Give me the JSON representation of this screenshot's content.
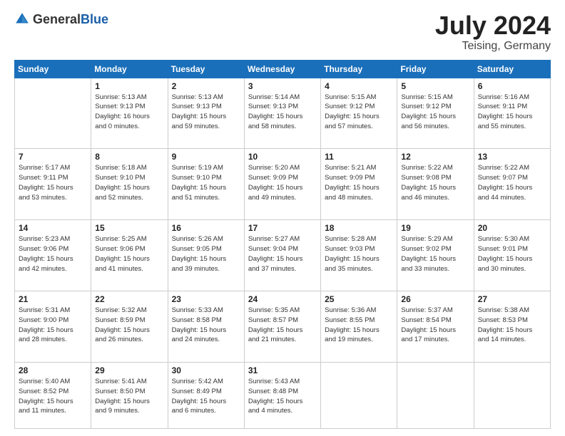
{
  "header": {
    "logo_general": "General",
    "logo_blue": "Blue",
    "month_year": "July 2024",
    "location": "Teising, Germany"
  },
  "weekdays": [
    "Sunday",
    "Monday",
    "Tuesday",
    "Wednesday",
    "Thursday",
    "Friday",
    "Saturday"
  ],
  "weeks": [
    [
      {
        "day": "",
        "info": ""
      },
      {
        "day": "1",
        "info": "Sunrise: 5:13 AM\nSunset: 9:13 PM\nDaylight: 16 hours\nand 0 minutes."
      },
      {
        "day": "2",
        "info": "Sunrise: 5:13 AM\nSunset: 9:13 PM\nDaylight: 15 hours\nand 59 minutes."
      },
      {
        "day": "3",
        "info": "Sunrise: 5:14 AM\nSunset: 9:13 PM\nDaylight: 15 hours\nand 58 minutes."
      },
      {
        "day": "4",
        "info": "Sunrise: 5:15 AM\nSunset: 9:12 PM\nDaylight: 15 hours\nand 57 minutes."
      },
      {
        "day": "5",
        "info": "Sunrise: 5:15 AM\nSunset: 9:12 PM\nDaylight: 15 hours\nand 56 minutes."
      },
      {
        "day": "6",
        "info": "Sunrise: 5:16 AM\nSunset: 9:11 PM\nDaylight: 15 hours\nand 55 minutes."
      }
    ],
    [
      {
        "day": "7",
        "info": "Sunrise: 5:17 AM\nSunset: 9:11 PM\nDaylight: 15 hours\nand 53 minutes."
      },
      {
        "day": "8",
        "info": "Sunrise: 5:18 AM\nSunset: 9:10 PM\nDaylight: 15 hours\nand 52 minutes."
      },
      {
        "day": "9",
        "info": "Sunrise: 5:19 AM\nSunset: 9:10 PM\nDaylight: 15 hours\nand 51 minutes."
      },
      {
        "day": "10",
        "info": "Sunrise: 5:20 AM\nSunset: 9:09 PM\nDaylight: 15 hours\nand 49 minutes."
      },
      {
        "day": "11",
        "info": "Sunrise: 5:21 AM\nSunset: 9:09 PM\nDaylight: 15 hours\nand 48 minutes."
      },
      {
        "day": "12",
        "info": "Sunrise: 5:22 AM\nSunset: 9:08 PM\nDaylight: 15 hours\nand 46 minutes."
      },
      {
        "day": "13",
        "info": "Sunrise: 5:22 AM\nSunset: 9:07 PM\nDaylight: 15 hours\nand 44 minutes."
      }
    ],
    [
      {
        "day": "14",
        "info": "Sunrise: 5:23 AM\nSunset: 9:06 PM\nDaylight: 15 hours\nand 42 minutes."
      },
      {
        "day": "15",
        "info": "Sunrise: 5:25 AM\nSunset: 9:06 PM\nDaylight: 15 hours\nand 41 minutes."
      },
      {
        "day": "16",
        "info": "Sunrise: 5:26 AM\nSunset: 9:05 PM\nDaylight: 15 hours\nand 39 minutes."
      },
      {
        "day": "17",
        "info": "Sunrise: 5:27 AM\nSunset: 9:04 PM\nDaylight: 15 hours\nand 37 minutes."
      },
      {
        "day": "18",
        "info": "Sunrise: 5:28 AM\nSunset: 9:03 PM\nDaylight: 15 hours\nand 35 minutes."
      },
      {
        "day": "19",
        "info": "Sunrise: 5:29 AM\nSunset: 9:02 PM\nDaylight: 15 hours\nand 33 minutes."
      },
      {
        "day": "20",
        "info": "Sunrise: 5:30 AM\nSunset: 9:01 PM\nDaylight: 15 hours\nand 30 minutes."
      }
    ],
    [
      {
        "day": "21",
        "info": "Sunrise: 5:31 AM\nSunset: 9:00 PM\nDaylight: 15 hours\nand 28 minutes."
      },
      {
        "day": "22",
        "info": "Sunrise: 5:32 AM\nSunset: 8:59 PM\nDaylight: 15 hours\nand 26 minutes."
      },
      {
        "day": "23",
        "info": "Sunrise: 5:33 AM\nSunset: 8:58 PM\nDaylight: 15 hours\nand 24 minutes."
      },
      {
        "day": "24",
        "info": "Sunrise: 5:35 AM\nSunset: 8:57 PM\nDaylight: 15 hours\nand 21 minutes."
      },
      {
        "day": "25",
        "info": "Sunrise: 5:36 AM\nSunset: 8:55 PM\nDaylight: 15 hours\nand 19 minutes."
      },
      {
        "day": "26",
        "info": "Sunrise: 5:37 AM\nSunset: 8:54 PM\nDaylight: 15 hours\nand 17 minutes."
      },
      {
        "day": "27",
        "info": "Sunrise: 5:38 AM\nSunset: 8:53 PM\nDaylight: 15 hours\nand 14 minutes."
      }
    ],
    [
      {
        "day": "28",
        "info": "Sunrise: 5:40 AM\nSunset: 8:52 PM\nDaylight: 15 hours\nand 11 minutes."
      },
      {
        "day": "29",
        "info": "Sunrise: 5:41 AM\nSunset: 8:50 PM\nDaylight: 15 hours\nand 9 minutes."
      },
      {
        "day": "30",
        "info": "Sunrise: 5:42 AM\nSunset: 8:49 PM\nDaylight: 15 hours\nand 6 minutes."
      },
      {
        "day": "31",
        "info": "Sunrise: 5:43 AM\nSunset: 8:48 PM\nDaylight: 15 hours\nand 4 minutes."
      },
      {
        "day": "",
        "info": ""
      },
      {
        "day": "",
        "info": ""
      },
      {
        "day": "",
        "info": ""
      }
    ]
  ]
}
